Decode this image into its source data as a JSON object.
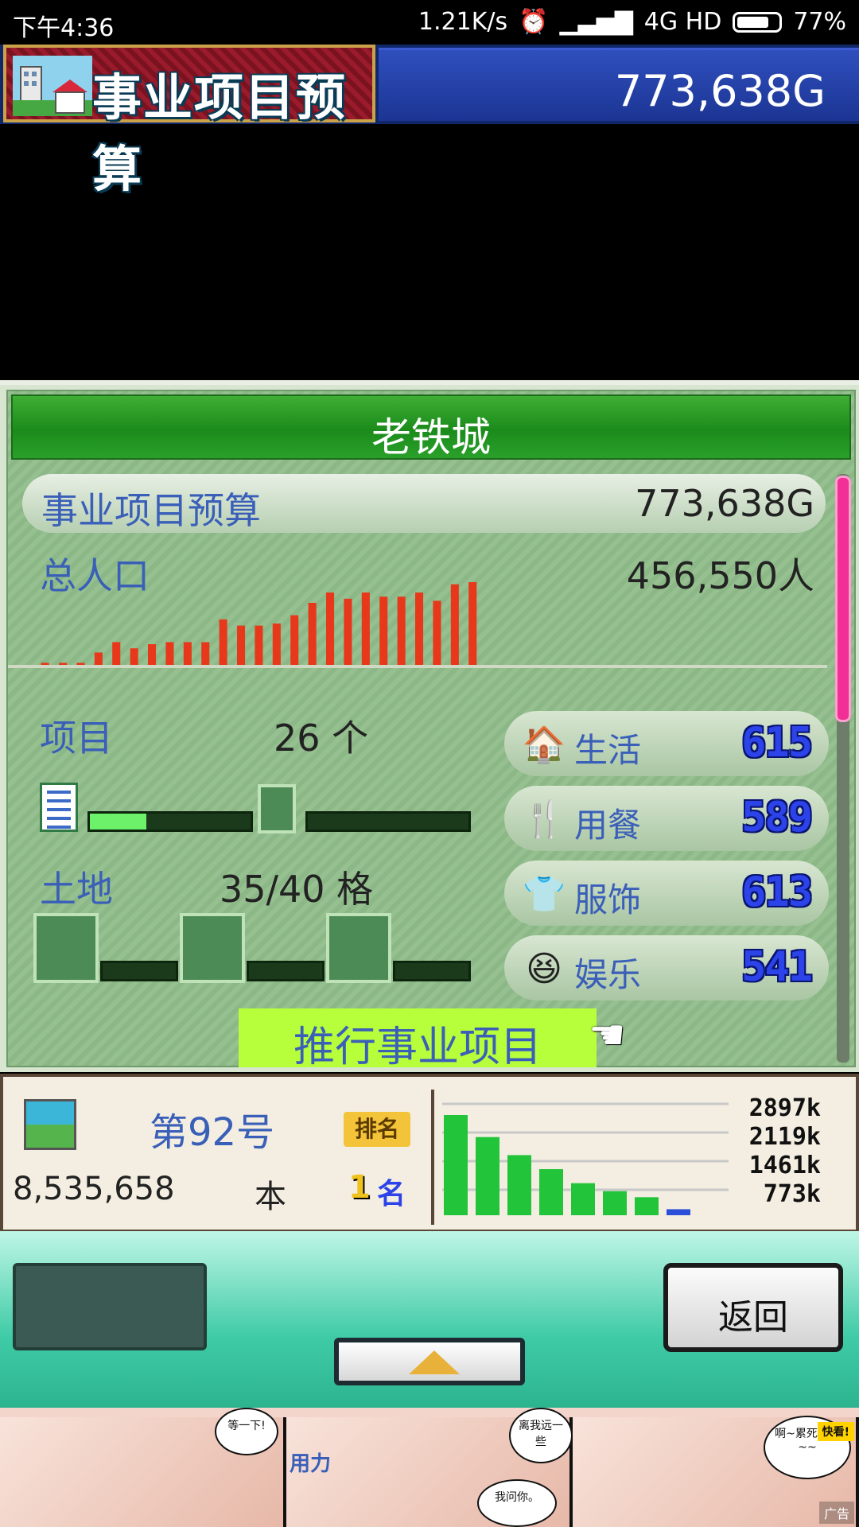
{
  "status_bar": {
    "time": "下午4:36",
    "net_speed": "1.21K/s",
    "network": "4G HD",
    "battery": "77%",
    "battery_level": 0.77
  },
  "header": {
    "title": "事业项目预算",
    "money": "773,638G"
  },
  "panel": {
    "city_name": "老铁城",
    "budget_label": "事业项目预算",
    "budget_value": "773,638G",
    "population_label": "总人口",
    "population_value": "456,550人",
    "projects_label": "项目",
    "projects_value": "26 个",
    "project_progress": 0.35,
    "land_label": "土地",
    "land_value": "35/40 格",
    "push_button": "推行事业项目",
    "categories": [
      {
        "icon": "house-icon",
        "label": "生活",
        "value": "615"
      },
      {
        "icon": "utensils-icon",
        "label": "用餐",
        "value": "589"
      },
      {
        "icon": "shirt-icon",
        "label": "服饰",
        "value": "613"
      },
      {
        "icon": "smiley-icon",
        "label": "娱乐",
        "value": "541"
      }
    ]
  },
  "chart_data": [
    {
      "type": "bar",
      "values": [
        2,
        2,
        2,
        12,
        22,
        16,
        20,
        22,
        22,
        22,
        44,
        38,
        38,
        40,
        48,
        60,
        70,
        64,
        70,
        66,
        66,
        70,
        62,
        78,
        80
      ]
    },
    {
      "type": "bar",
      "values": [
        100,
        78,
        60,
        46,
        32,
        24,
        18,
        6
      ]
    }
  ],
  "ranking": {
    "issue": "第92号",
    "badge": "排名",
    "sales": "8,535,658",
    "unit": "本",
    "rank_number": "1",
    "rank_suffix": "名",
    "chart_numbers": [
      "2897k",
      "2119k",
      "1461k",
      "773k"
    ]
  },
  "controls": {
    "back_label": "返回"
  },
  "ad": {
    "tag": "快看!",
    "label": "广告",
    "bubble1": "等一下!",
    "bubble2": "离我远一些",
    "bubble3": "我问你。",
    "bubble4": "啊~累死我啦~~",
    "side_text": "用力"
  },
  "colors": {
    "accent_green": "#1b8b1b",
    "header_blue": "#1c3594",
    "bar_red": "#e8381b",
    "bar_green": "#22c43a",
    "scroll_pink": "#f12f97"
  }
}
